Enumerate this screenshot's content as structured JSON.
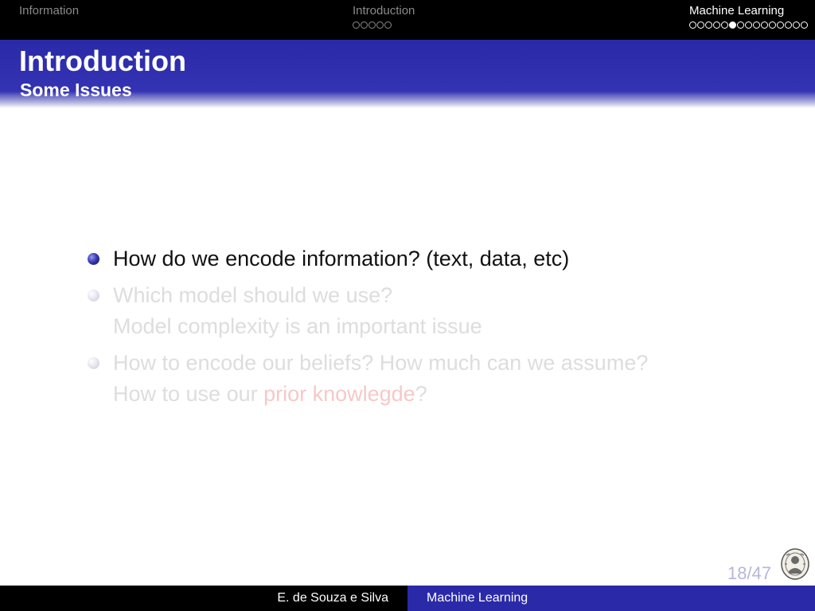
{
  "nav": {
    "sections": [
      {
        "label": "Information",
        "dots_total": 0,
        "dots_filled": -1,
        "active": false
      },
      {
        "label": "Introduction",
        "dots_total": 5,
        "dots_filled": -1,
        "active": false
      },
      {
        "label": "Machine Learning",
        "dots_total": 15,
        "dots_filled": 5,
        "active": true
      }
    ]
  },
  "frame": {
    "title": "Introduction",
    "subtitle": "Some Issues"
  },
  "items": [
    {
      "lines": [
        "How do we encode information? (text, data, etc)"
      ]
    },
    {
      "lines": [
        "Which model should we use?",
        "Model complexity is an important issue"
      ]
    },
    {
      "line1": "How to encode our beliefs? How much can we assume?",
      "line2_pre": "How to use our ",
      "line2_highlight": "prior knowlegde",
      "line2_post": "?"
    }
  ],
  "page": {
    "current": "18",
    "total": "47",
    "label": "18/47"
  },
  "footer": {
    "author": "E. de Souza e Silva",
    "title": "Machine Learning"
  },
  "colors": {
    "title_band": "#3333b3",
    "nav_bg": "#000000",
    "highlight": "#f7c8c8",
    "dim_text": "#dddddd"
  }
}
